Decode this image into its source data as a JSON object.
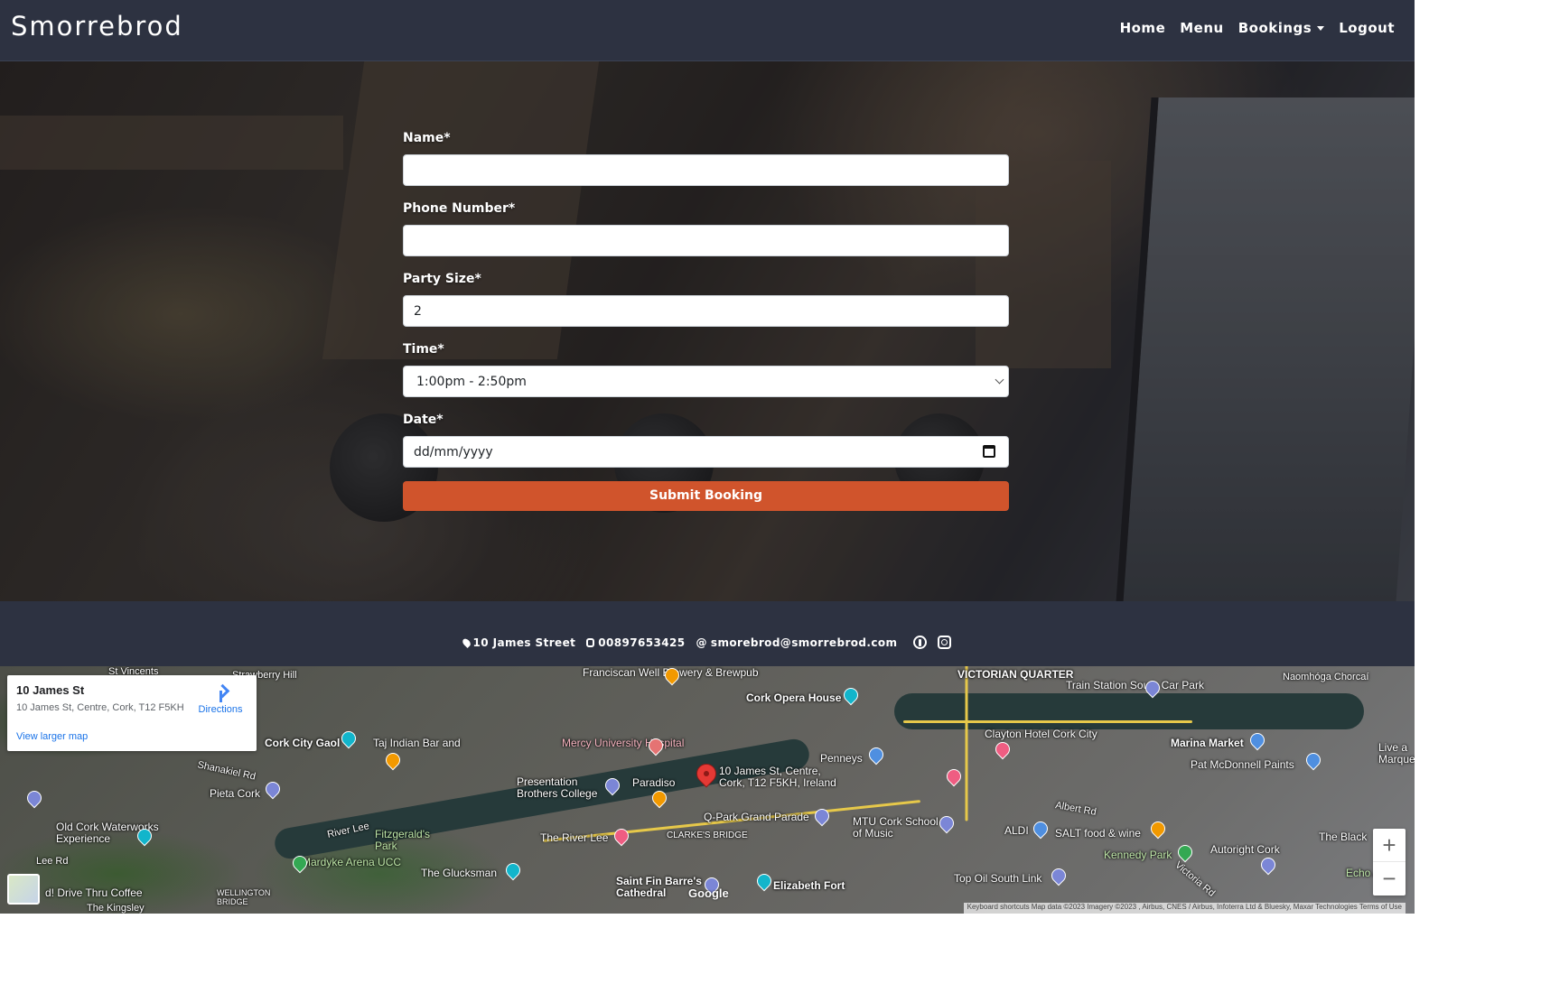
{
  "navbar": {
    "brand": "Smorrebrod",
    "links": [
      "Home",
      "Menu",
      "Bookings",
      "Logout"
    ]
  },
  "form": {
    "name_label": "Name*",
    "name_value": "",
    "phone_label": "Phone Number*",
    "phone_value": "",
    "party_label": "Party Size*",
    "party_value": "2",
    "time_label": "Time*",
    "time_value": "1:00pm - 2:50pm",
    "date_label": "Date*",
    "date_placeholder": "dd/mm/yyyy",
    "submit_label": "Submit Booking",
    "submit_color": "#d0542c"
  },
  "footer": {
    "address": "10 James Street",
    "phone": "00897653425",
    "email": "smorebrod@smorrebrod.com",
    "icons": [
      "map-marker-icon",
      "phone-icon",
      "at-icon",
      "pinterest-icon",
      "instagram-icon"
    ]
  },
  "map": {
    "card": {
      "title": "10 James St",
      "address": "10 James St, Centre, Cork, T12 F5KH",
      "directions": "Directions",
      "larger_map": "View larger map"
    },
    "labels": [
      "Franciscan Well Brewery & Brewpub",
      "Cork Opera House",
      "VICTORIAN QUARTER",
      "Train Station South Car Park",
      "Cork City Gaol",
      "Taj Indian Bar and",
      "Mercy University Hospital",
      "Clayton Hotel Cork City",
      "Marina Market",
      "Penneys",
      "10 James St, Centre, Cork, T12 F5KH, Ireland",
      "Presentation Brothers College",
      "Paradiso",
      "Pat McDonnell Paints",
      "Shanakiel Rd",
      "Pieta Cork",
      "Q-Park Grand Parade",
      "MTU Cork School of Music",
      "ALDI",
      "SALT food & wine",
      "Albert Rd",
      "Old Cork Waterworks Experience",
      "Fitzgerald's Park",
      "The River Lee",
      "CLARKE'S BRIDGE",
      "Kennedy Park",
      "Autoright Cork",
      "The Black",
      "Lee Rd",
      "Mardyke Arena UCC",
      "The Glucksman",
      "Saint Fin Barre's Cathedral",
      "Elizabeth Fort",
      "Top Oil South Link",
      "Echo Athl",
      "d! Drive Thru Coffee",
      "River Lee",
      "Victoria Rd",
      "WELLINGTON BRIDGE",
      "The Kingsley",
      "St Vincents",
      "Strawberry Hill",
      "Naomhóga Chorcaí",
      "Live a Marquee"
    ],
    "google": "Google",
    "attribution": "Keyboard shortcuts  Map data ©2023 Imagery ©2023 , Airbus, CNES / Airbus, Infoterra Ltd & Bluesky, Maxar Technologies  Terms of Use",
    "zoom_in": "+",
    "zoom_out": "−",
    "pin_color": "#e53935"
  }
}
